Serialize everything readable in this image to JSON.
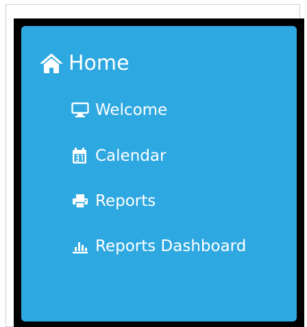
{
  "menu": {
    "home": {
      "label": "Home",
      "icon": "home-icon"
    },
    "items": [
      {
        "label": "Welcome",
        "icon": "monitor-icon"
      },
      {
        "label": "Calendar",
        "icon": "calendar-icon"
      },
      {
        "label": "Reports",
        "icon": "printer-icon"
      },
      {
        "label": "Reports Dashboard",
        "icon": "bar-chart-icon"
      }
    ]
  },
  "colors": {
    "panel_background": "#2ea8e0",
    "frame_border": "#000000",
    "text": "#ffffff"
  }
}
